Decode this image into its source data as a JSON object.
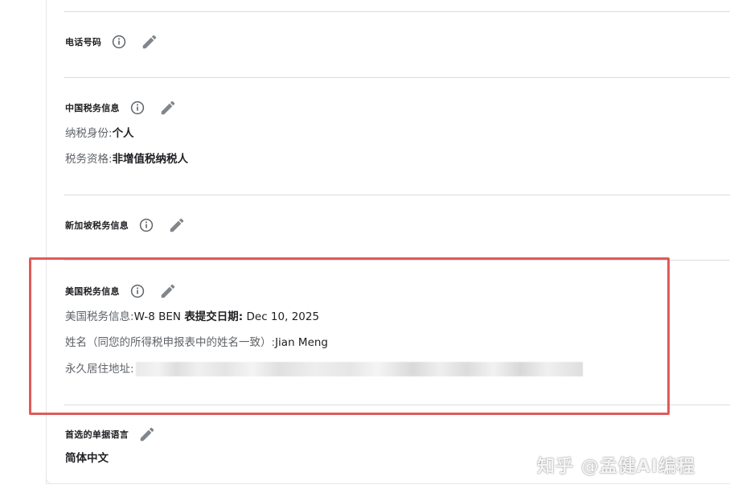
{
  "phone": {
    "title": "电话号码"
  },
  "china_tax": {
    "title": "中国税务信息",
    "rows": [
      {
        "label": "纳税身份:",
        "value": "个人"
      },
      {
        "label": "税务资格:",
        "value": "非增值税纳税人"
      }
    ]
  },
  "singapore_tax": {
    "title": "新加坡税务信息"
  },
  "us_tax": {
    "title": "美国税务信息",
    "info_label": "美国税务信息:",
    "form_value": "W-8 BEN",
    "submit_label": "表提交日期:",
    "submit_date": "Dec 10, 2025",
    "name_label": "姓名（同您的所得税申报表中的姓名一致）:",
    "name_value": "Jian Meng",
    "address_label": "永久居住地址:"
  },
  "language": {
    "title": "首选的单据语言",
    "value": "简体中文"
  },
  "watermark": "知乎 @孟健AI编程",
  "colors": {
    "highlight_border": "#e05a5a",
    "icon_gray": "#5f6368",
    "divider": "#dadce0"
  },
  "icons": {
    "info": "info-circle-icon",
    "edit": "pencil-icon"
  }
}
